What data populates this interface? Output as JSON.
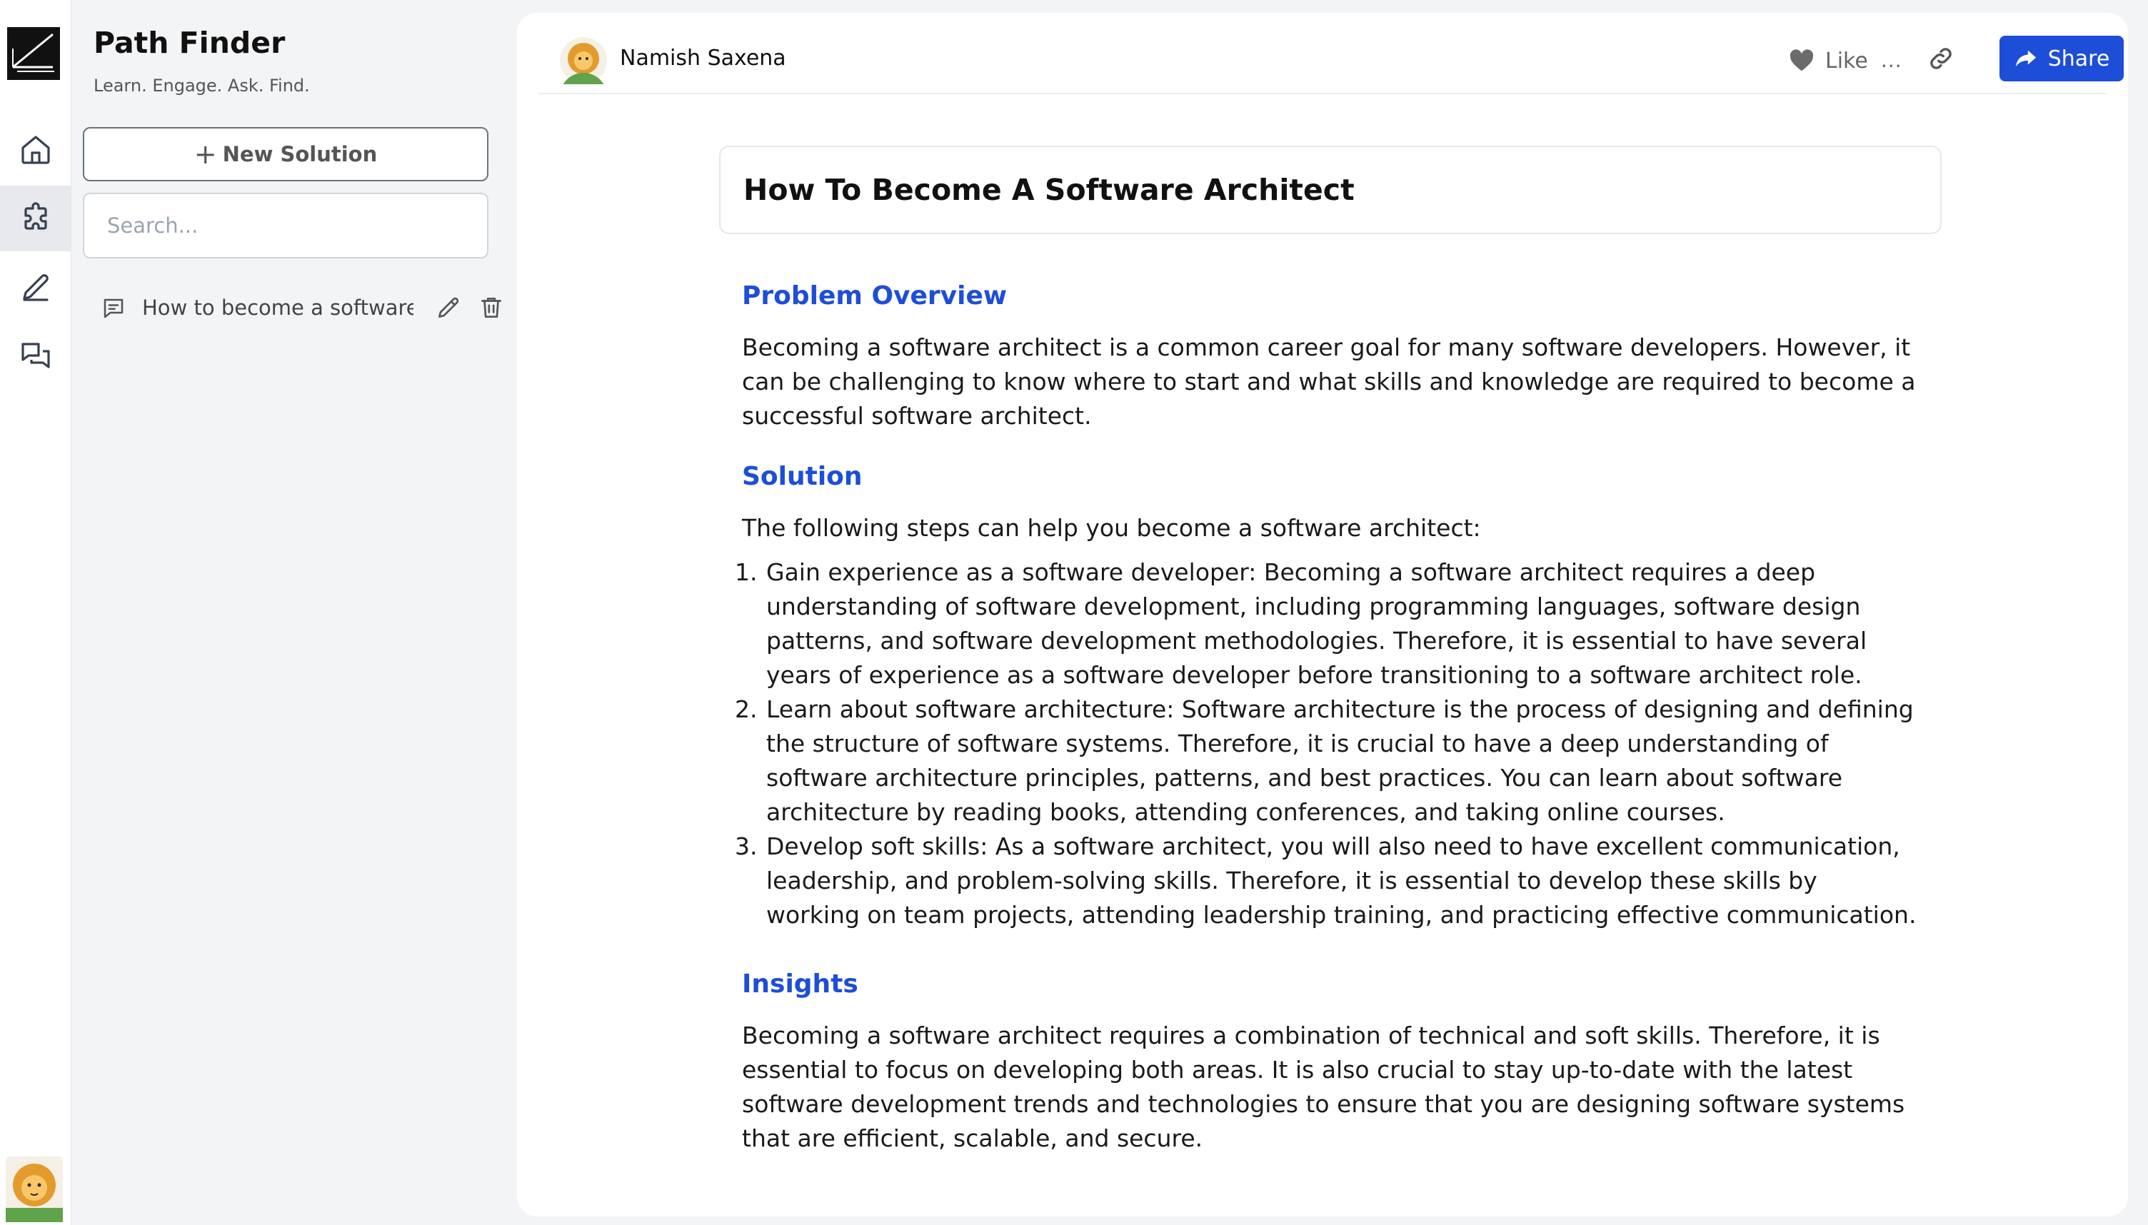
{
  "app": {
    "name": "Path Finder",
    "tagline": "Learn. Engage. Ask. Find."
  },
  "rail": {
    "items": [
      {
        "icon": "home-icon",
        "active": false
      },
      {
        "icon": "puzzle-icon",
        "active": true
      },
      {
        "icon": "pencil-icon",
        "active": false
      },
      {
        "icon": "chat-icon",
        "active": false
      }
    ]
  },
  "sidebar": {
    "new_button_label": "New Solution",
    "search_placeholder": "Search...",
    "items": [
      {
        "label": "How to become a software architect"
      }
    ]
  },
  "topbar": {
    "author": "Namish Saxena",
    "like_label": "Like",
    "more_label": "...",
    "share_label": "Share"
  },
  "doc": {
    "title": "How To Become A Software Architect",
    "overview_heading": "Problem Overview",
    "overview_text": "Becoming a software architect is a common career goal for many software developers. However, it can be challenging to know where to start and what skills and knowledge are required to become a successful software architect.",
    "solution_heading": "Solution",
    "solution_intro": "The following steps can help you become a software architect:",
    "steps": [
      "Gain experience as a software developer: Becoming a software architect requires a deep understanding of software development, including programming languages, software design patterns, and software development methodologies. Therefore, it is essential to have several years of experience as a software developer before transitioning to a software architect role.",
      "Learn about software architecture: Software architecture is the process of designing and defining the structure of software systems. Therefore, it is crucial to have a deep understanding of software architecture principles, patterns, and best practices. You can learn about software architecture by reading books, attending conferences, and taking online courses.",
      "Develop soft skills: As a software architect, you will also need to have excellent communication, leadership, and problem-solving skills. Therefore, it is essential to develop these skills by working on team projects, attending leadership training, and practicing effective communication."
    ],
    "insights_heading": "Insights",
    "insights_text": "Becoming a software architect requires a combination of technical and soft skills. Therefore, it is essential to focus on developing both areas. It is also crucial to stay up-to-date with the latest software development trends and technologies to ensure that you are designing software systems that are efficient, scalable, and secure."
  },
  "colors": {
    "accent": "#1d4ed8",
    "rail_active": "#e8e9ec",
    "sidebar_bg": "#f3f4f6"
  }
}
